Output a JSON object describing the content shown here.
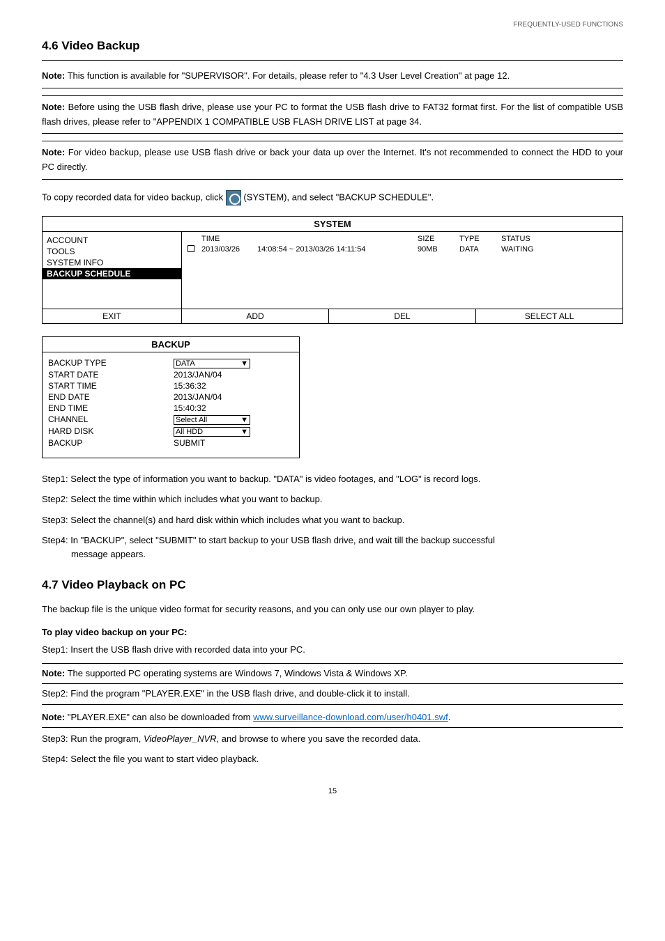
{
  "header": {
    "right": "FREQUENTLY-USED FUNCTIONS"
  },
  "section46": {
    "title": "4.6 Video Backup",
    "note1": {
      "label": "Note:",
      "text": "This function is available for \"SUPERVISOR\". For details, please refer to \"4.3 User Level Creation\" at page 12."
    },
    "note2": {
      "label": "Note:",
      "text": "Before using the USB flash drive, please use your PC to format the USB flash drive to FAT32 format first. For the list of compatible USB flash drives, please refer to \"APPENDIX 1 COMPATIBLE USB FLASH DRIVE LIST at page 34."
    },
    "note3": {
      "label": "Note:",
      "text": "For video backup, please use USB flash drive or back your data up over the Internet. It's not recommended to connect the HDD to your PC directly."
    },
    "intro_a": "To copy recorded data for video backup, click ",
    "intro_b": " (SYSTEM), and select \"BACKUP SCHEDULE\"."
  },
  "systemPanel": {
    "title": "SYSTEM",
    "sidebar": [
      "ACCOUNT",
      "TOOLS",
      "SYSTEM INFO",
      "BACKUP SCHEDULE"
    ],
    "cols": {
      "time": "TIME",
      "size": "SIZE",
      "type": "TYPE",
      "status": "STATUS"
    },
    "row": {
      "time": "2013/03/26",
      "range": "14:08:54 ~ 2013/03/26 14:11:54",
      "size": "90MB",
      "type": "DATA",
      "status": "WAITING"
    },
    "bottom": {
      "exit": "EXIT",
      "add": "ADD",
      "del": "DEL",
      "selectAll": "SELECT ALL"
    }
  },
  "backupPanel": {
    "title": "BACKUP",
    "rows": {
      "backupType": {
        "label": "BACKUP TYPE",
        "value": "DATA"
      },
      "startDate": {
        "label": "START DATE",
        "value": "2013/JAN/04"
      },
      "startTime": {
        "label": "START TIME",
        "value": "15:36:32"
      },
      "endDate": {
        "label": "END DATE",
        "value": "2013/JAN/04"
      },
      "endTime": {
        "label": "END TIME",
        "value": "15:40:32"
      },
      "channel": {
        "label": "CHANNEL",
        "value": "Select All"
      },
      "hardDisk": {
        "label": "HARD DISK",
        "value": "All HDD"
      },
      "backup": {
        "label": "BACKUP",
        "value": "SUBMIT"
      }
    }
  },
  "steps46": {
    "s1": "Step1: Select the type of information you want to backup. \"DATA\" is video footages, and \"LOG\" is record logs.",
    "s2": "Step2: Select the time within which includes what you want to backup.",
    "s3": "Step3: Select the channel(s) and hard disk within which includes what you want to backup.",
    "s4a": "Step4: In \"BACKUP\", select \"SUBMIT\" to start backup to your USB flash drive, and wait till the backup successful",
    "s4b": "message appears."
  },
  "section47": {
    "title": "4.7 Video Playback on PC",
    "intro": "The backup file is the unique video format for security reasons, and you can only use our own player to play.",
    "subhead": "To play video backup on your PC:",
    "s1": "Step1: Insert the USB flash drive with recorded data into your PC.",
    "note1": {
      "label": "Note:",
      "text": "The supported PC operating systems are Windows 7, Windows Vista & Windows XP."
    },
    "s2": "Step2: Find the program \"PLAYER.EXE\" in the USB flash drive, and double-click it to install.",
    "note2": {
      "label": "Note:",
      "text_a": "\"PLAYER.EXE\" can also be downloaded from ",
      "link": "www.surveillance-download.com/user/h0401.swf",
      "text_b": "."
    },
    "s3a": "Step3: Run the program, ",
    "s3b": "VideoPlayer_NVR",
    "s3c": ", and browse to where you save the recorded data.",
    "s4": "Step4: Select the file you want to start video playback."
  },
  "pageNum": "15"
}
